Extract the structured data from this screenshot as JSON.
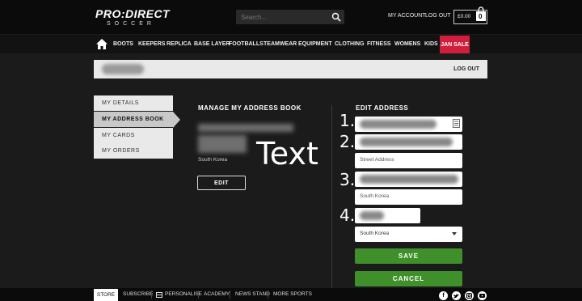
{
  "header": {
    "logo_main": "PRO:DIRECT",
    "logo_sub": "SOCCER",
    "search_placeholder": "Search...",
    "my_account": "MY ACCOUNT",
    "log_out": "LOG OUT",
    "basket_amount": "£0.00",
    "basket_count": "0"
  },
  "nav": {
    "items": [
      "BOOTS",
      "KEEPERS",
      "REPLICA",
      "BASE LAYER",
      "FOOTBALLS",
      "TEAMWEAR",
      "EQUIPMENT",
      "CLOTHING",
      "FITNESS",
      "WOMENS",
      "KIDS"
    ],
    "sale": "JAN SALE"
  },
  "userbar": {
    "logout": "LOG OUT"
  },
  "sidebar": {
    "items": [
      "MY DETAILS",
      "MY ADDRESS BOOK",
      "MY CARDS",
      "MY ORDERS"
    ],
    "active_index": 1
  },
  "address_book": {
    "title": "MANAGE MY ADDRESS BOOK",
    "country": "South Korea",
    "edit": "EDIT"
  },
  "overlay_text": "Text",
  "edit_address": {
    "title": "EDIT ADDRESS",
    "markers": [
      "1.",
      "2.",
      "3.",
      "4."
    ],
    "street_placeholder": "Street Address",
    "region_value": "South Korea",
    "country_select": "South Korea",
    "save": "SAVE",
    "cancel": "CANCEL"
  },
  "footer": {
    "items": [
      "STORE",
      "SUBSCRIBE",
      "PERSONALISE",
      "ACADEMY",
      "NEWS STAND",
      "MORE SPORTS"
    ],
    "socials": [
      "facebook-icon",
      "twitter-icon",
      "instagram-icon",
      "youtube-icon"
    ]
  }
}
